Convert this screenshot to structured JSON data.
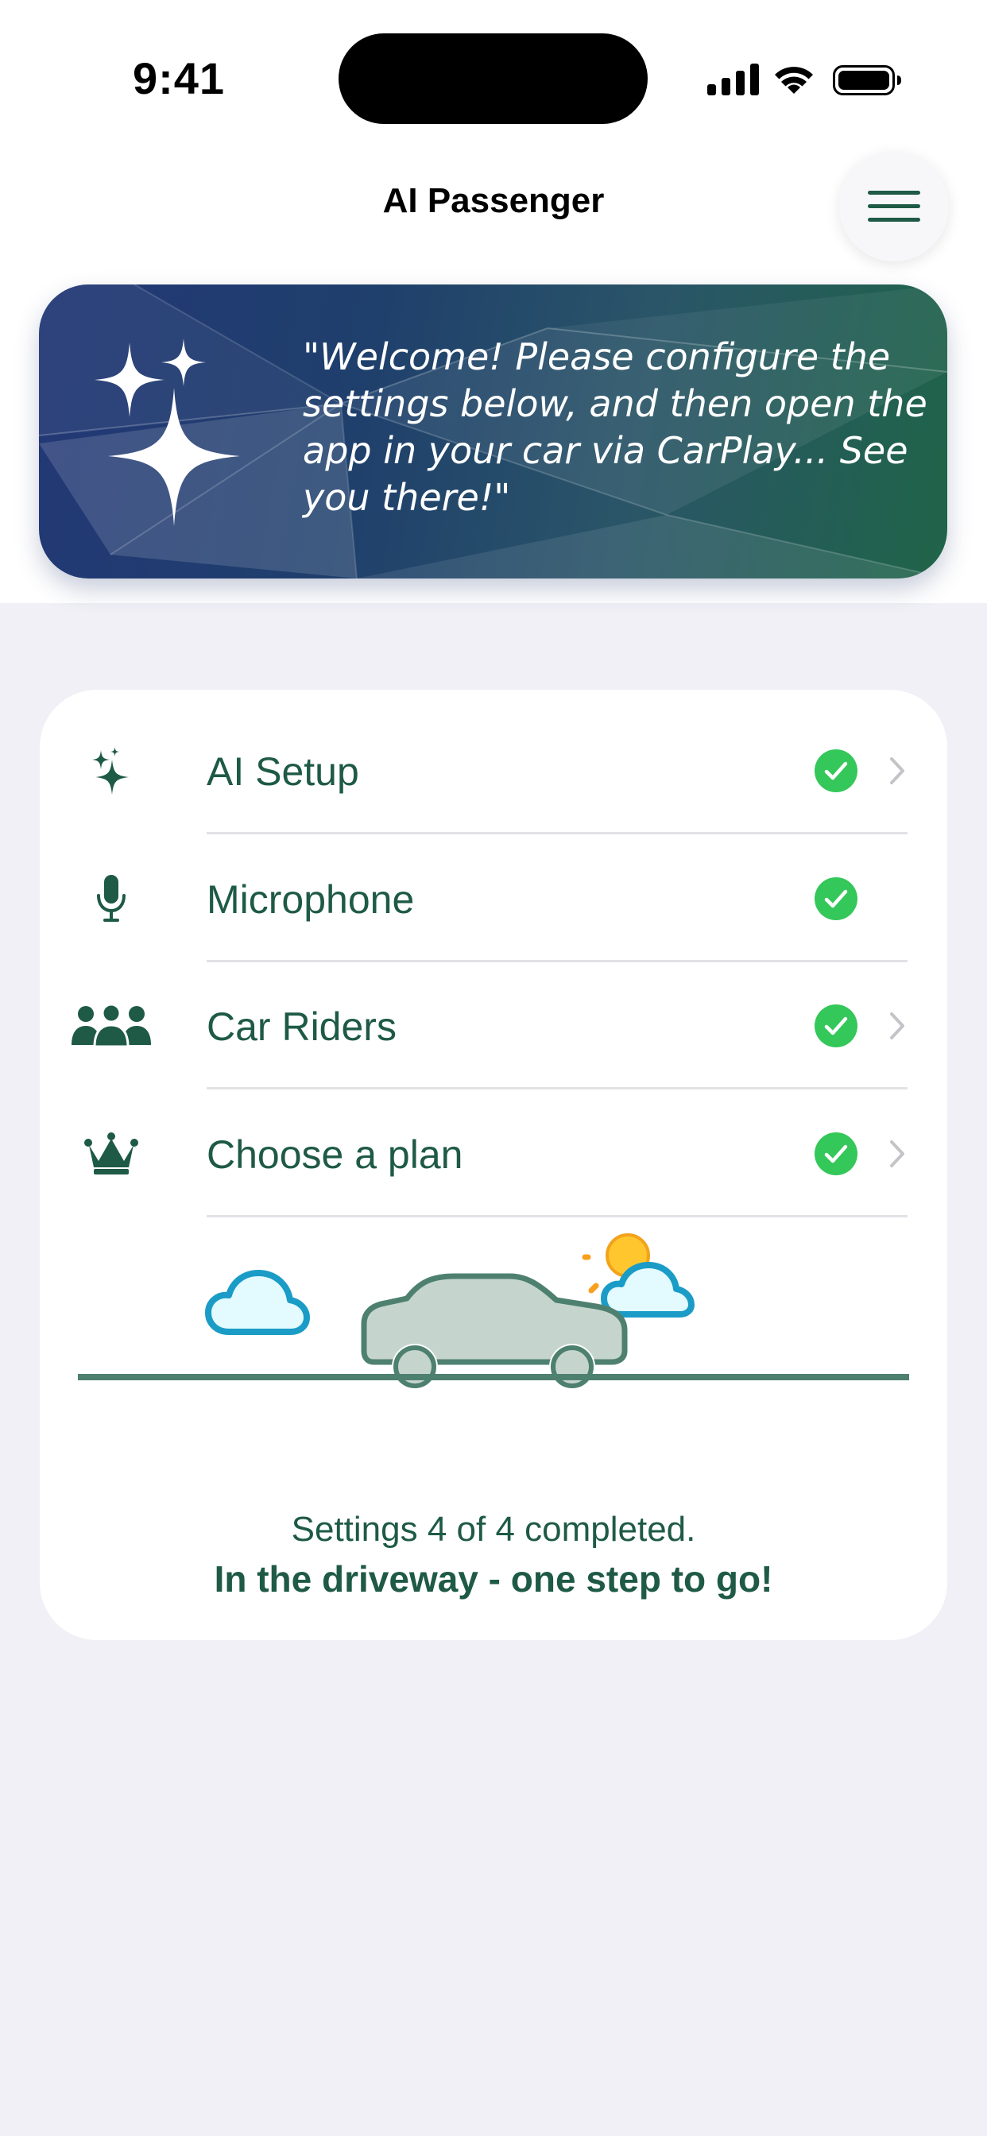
{
  "status_bar": {
    "time": "9:41"
  },
  "nav": {
    "title": "AI Passenger",
    "menu_icon": "hamburger-icon"
  },
  "banner": {
    "icon": "sparkles-icon",
    "message": "\"Welcome! Please configure the settings below, and then open the app in your car via CarPlay... See you there!\""
  },
  "settings": [
    {
      "label": "AI Setup",
      "icon": "sparkles-icon",
      "completed": true,
      "has_chevron": true
    },
    {
      "label": "Microphone",
      "icon": "microphone-icon",
      "completed": true,
      "has_chevron": false
    },
    {
      "label": "Car Riders",
      "icon": "people-icon",
      "completed": true,
      "has_chevron": true
    },
    {
      "label": "Choose a plan",
      "icon": "crown-icon",
      "completed": true,
      "has_chevron": true
    }
  ],
  "progress": {
    "text": "Settings 4 of 4 completed.",
    "subtext": "In the driveway - one step to go!",
    "completed": 4,
    "total": 4
  },
  "colors": {
    "accent_green": "#1e5a45",
    "check_green": "#34c759",
    "background": "#f0f0f6",
    "banner_start": "#233876",
    "banner_end": "#1f6448"
  }
}
